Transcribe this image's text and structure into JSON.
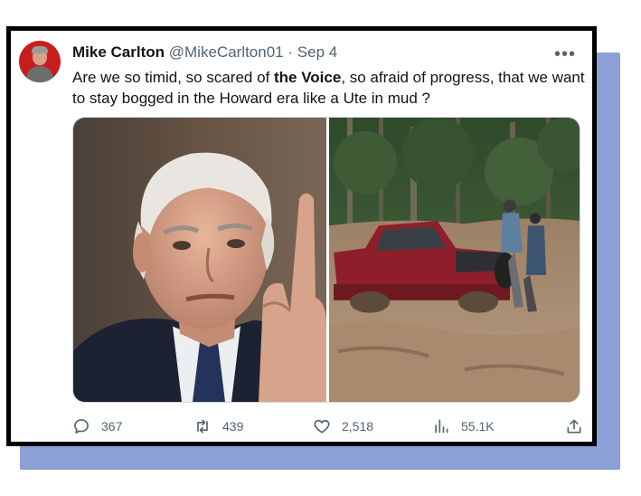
{
  "tweet": {
    "author_name": "Mike Carlton",
    "author_handle": "@MikeCarlton01",
    "separator": "·",
    "date": "Sep 4",
    "more_label": "•••",
    "text_before": "Are we so timid, so scared of ",
    "text_bold": "the Voice",
    "text_after": ", so afraid of progress, that we want to stay bogged in the Howard era like a Ute in mud ?"
  },
  "actions": {
    "replies": "367",
    "retweets": "439",
    "likes": "2,518",
    "views": "55.1K"
  },
  "icons": {
    "reply": "reply-icon",
    "retweet": "retweet-icon",
    "like": "heart-icon",
    "views": "views-icon",
    "share": "share-icon",
    "more": "more-icon"
  },
  "colors": {
    "frame": "#000000",
    "shadow": "#8c9fd6",
    "text": "#0f1419",
    "muted": "#536471",
    "avatar_bg": "#c81d1d"
  }
}
